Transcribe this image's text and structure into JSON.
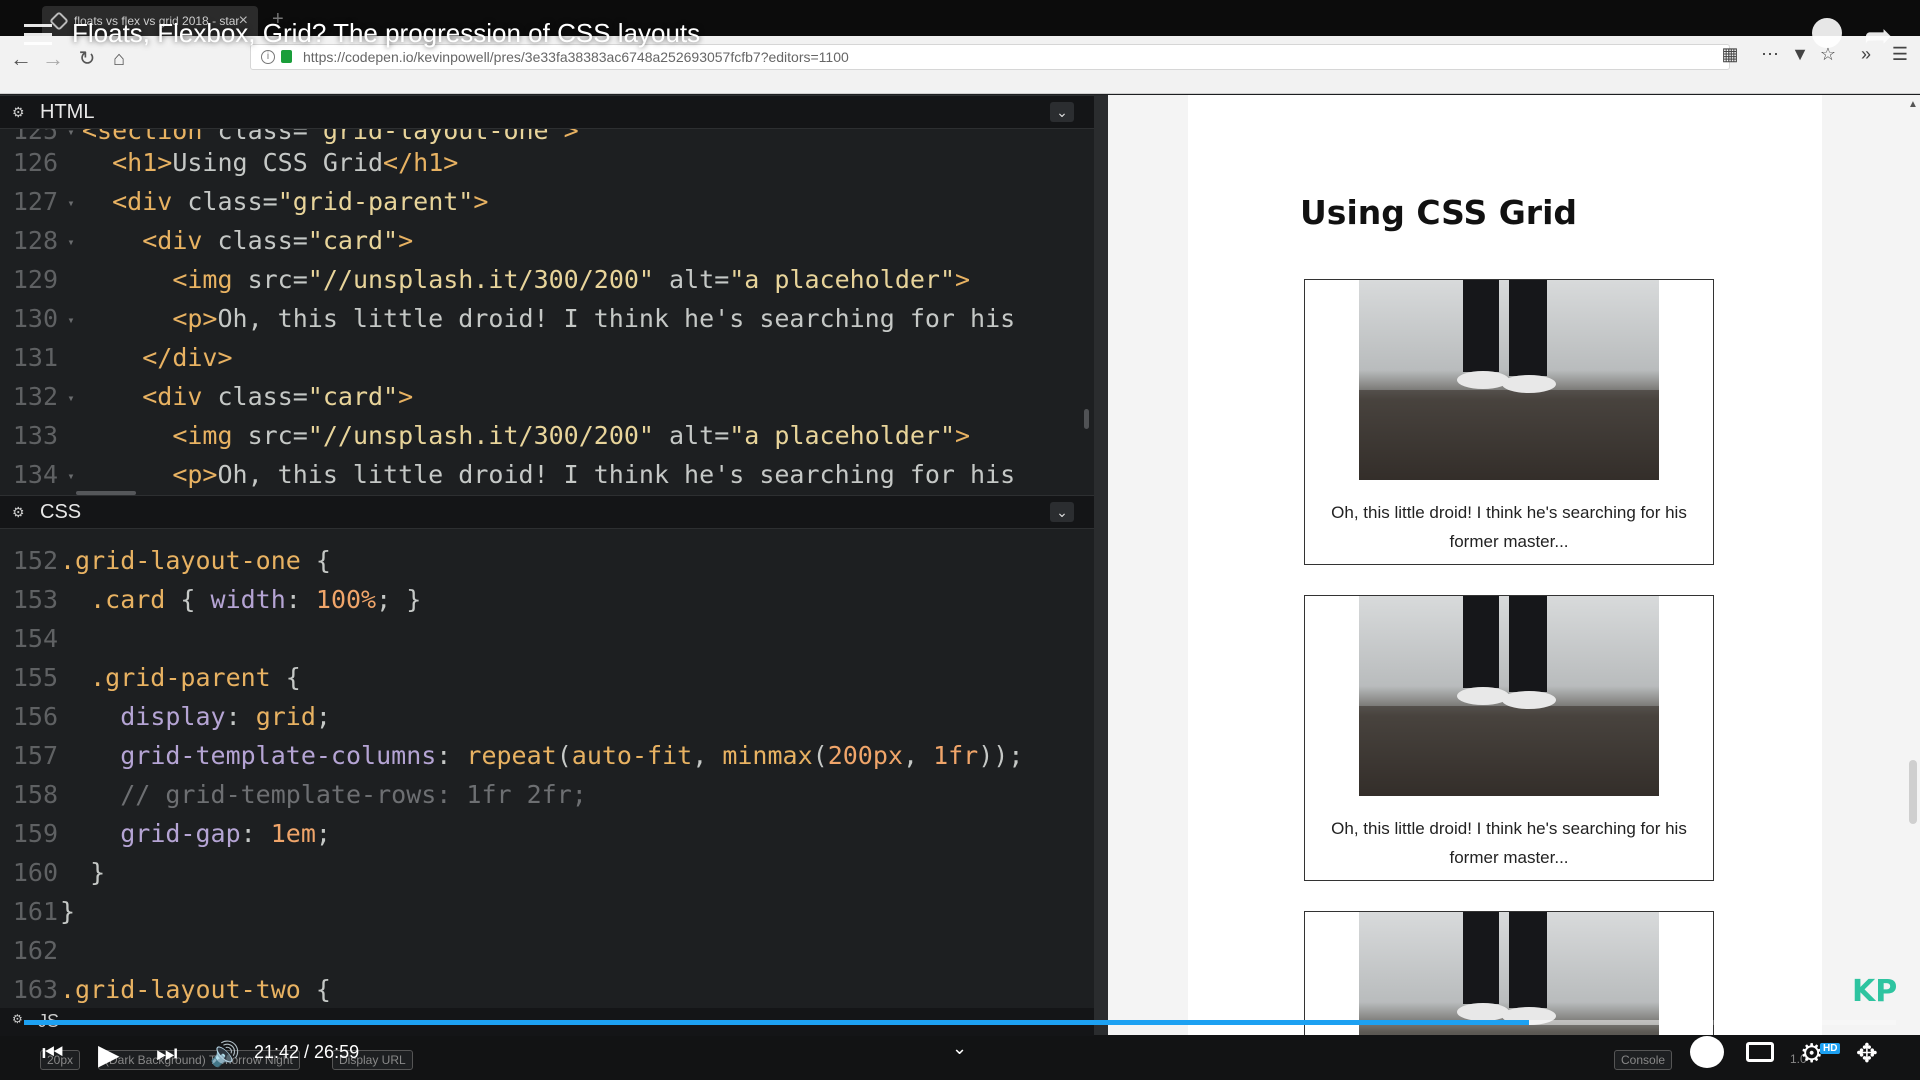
{
  "browser": {
    "tab_title": "floats vs flex vs grid 2018 - start",
    "tab_close": "×",
    "new_tab": "+",
    "url": "https://codepen.io/kevinpowell/pres/3e33fa38383ac6748a252693057fcfb7?editors=1100",
    "url_info": "i"
  },
  "video": {
    "title": "Floats, Flexbox, Grid? The progression of CSS layouts",
    "time": "21:42 / 26:59",
    "progress": 0.804,
    "buffered": 0.88,
    "hd_badge": "HD",
    "watermark": "KP"
  },
  "editor": {
    "html_panel_title": "HTML",
    "css_panel_title": "CSS",
    "js_panel_title": "JS",
    "collapse_glyph": "⌄"
  },
  "preview": {
    "heading": "Using CSS Grid",
    "cards": [
      {
        "caption": "Oh, this little droid! I think he's searching for his former master..."
      },
      {
        "caption": "Oh, this little droid! I think he's searching for his former master..."
      },
      {
        "caption": ""
      }
    ]
  },
  "footer": {
    "font_size": "20px",
    "theme": "(Dark Background) Tomorrow Night",
    "display_url": "Display URL",
    "console": "Console",
    "zoom": "1.0"
  },
  "colors": {
    "progress": "#1da1f2",
    "watermark": "#2ec4a0",
    "editor_bg": "#1d1f21"
  },
  "icons": [
    "menu-icon",
    "clock-icon",
    "share-icon",
    "back-icon",
    "forward-icon",
    "reload-icon",
    "home-icon",
    "lock-icon",
    "reader-icon",
    "more-icon",
    "pocket-icon",
    "bookmark-icon",
    "overflow-icon",
    "hamburger-icon",
    "gear-icon",
    "prev-icon",
    "play-icon",
    "next-icon",
    "volume-icon",
    "captions-icon",
    "settings-icon",
    "fullscreen-exit-icon"
  ]
}
